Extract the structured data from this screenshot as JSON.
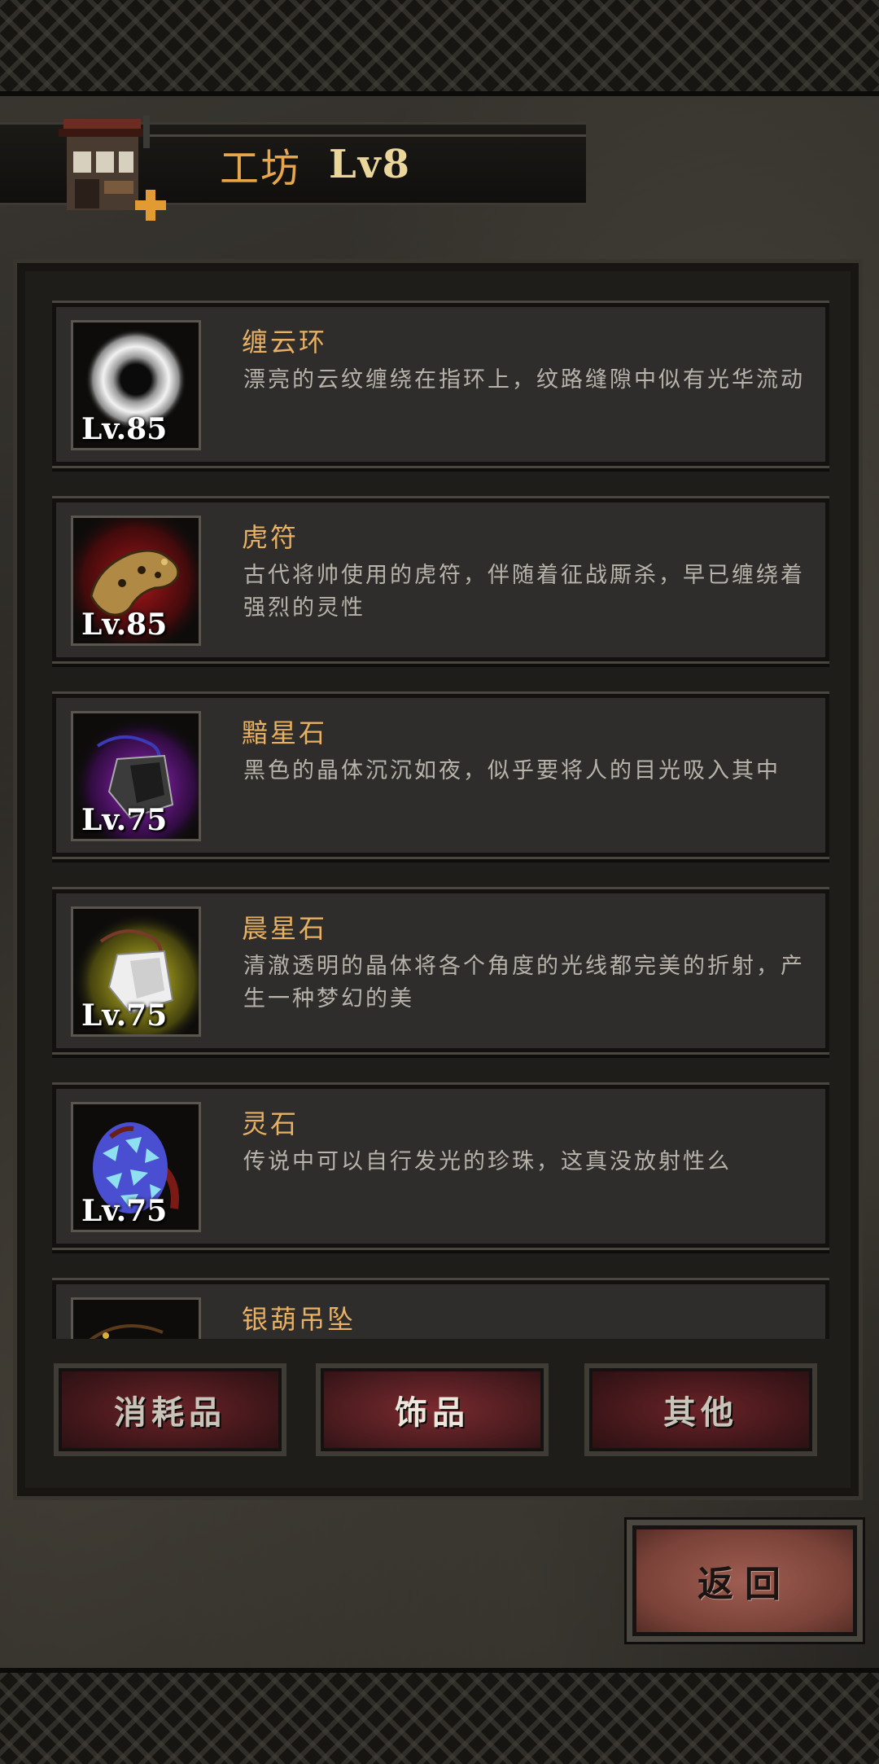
{
  "header": {
    "title": "工坊",
    "level": "Lv8"
  },
  "items": [
    {
      "name": "缠云环",
      "level": "Lv.85",
      "desc": "漂亮的云纹缠绕在指环上，纹路缝隙中似有光华流动",
      "icon": "cloud-ring-icon",
      "glow": "#000000"
    },
    {
      "name": "虎符",
      "level": "Lv.85",
      "desc": "古代将帅使用的虎符，伴随着征战厮杀，早已缠绕着强烈的灵性",
      "icon": "tiger-tally-icon",
      "glow": "#c0181c"
    },
    {
      "name": "黯星石",
      "level": "Lv.75",
      "desc": "黑色的晶体沉沉如夜，似乎要将人的目光吸入其中",
      "icon": "dark-star-stone-icon",
      "glow": "#8a1bb0"
    },
    {
      "name": "晨星石",
      "level": "Lv.75",
      "desc": "清澈透明的晶体将各个角度的光线都完美的折射，产生一种梦幻的美",
      "icon": "morning-star-stone-icon",
      "glow": "#d8d21a"
    },
    {
      "name": "灵石",
      "level": "Lv.75",
      "desc": "传说中可以自行发光的珍珠，这真没放射性么",
      "icon": "spirit-stone-icon",
      "glow": "#000000"
    },
    {
      "name": "银葫吊坠",
      "level": "",
      "desc": "",
      "icon": "silver-gourd-pendant-icon",
      "glow": "#000000"
    }
  ],
  "tabs": [
    {
      "label": "消耗品",
      "active": false
    },
    {
      "label": "饰品",
      "active": true
    },
    {
      "label": "其他",
      "active": false
    }
  ],
  "back_label": "返回",
  "colors": {
    "title": "#e8a64a",
    "item_name": "#e7b063",
    "desc": "#b7b3aa",
    "tab_bg": "#5a1e22"
  }
}
